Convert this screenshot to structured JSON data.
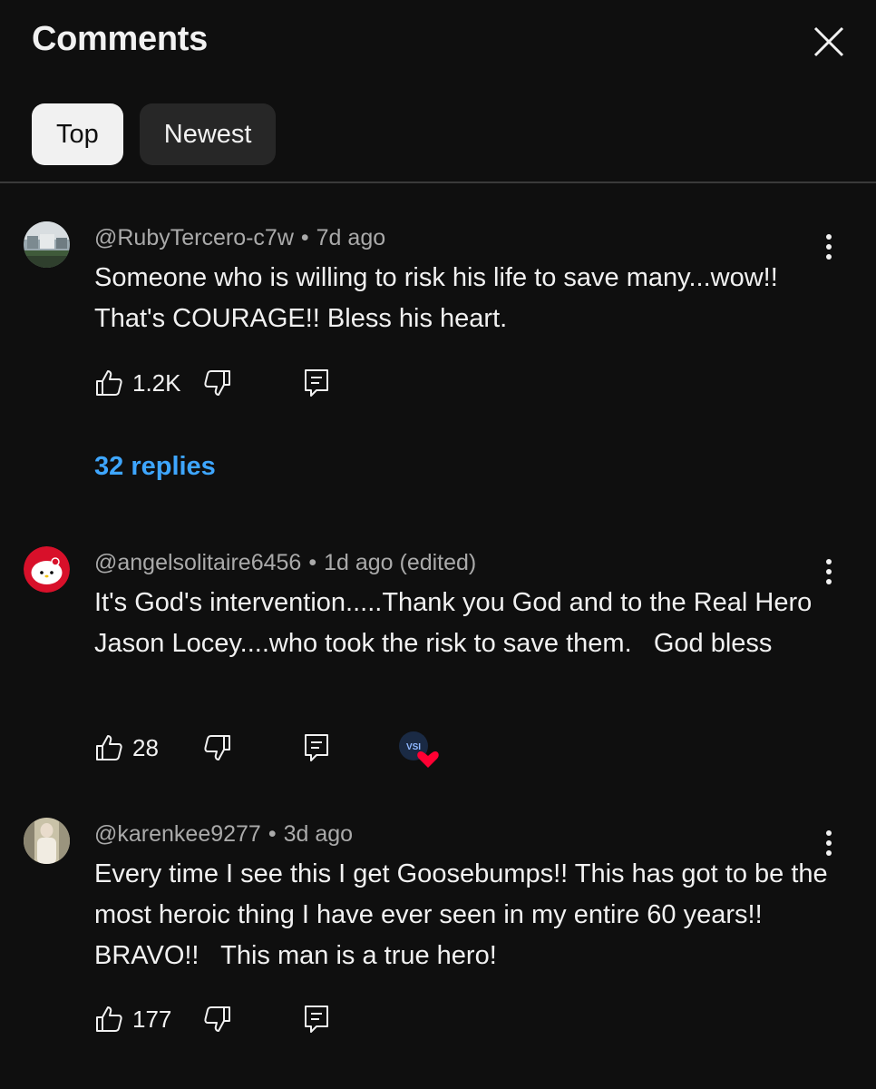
{
  "header": {
    "title": "Comments",
    "close_icon": "close-icon"
  },
  "tabs": [
    {
      "label": "Top",
      "active": true
    },
    {
      "label": "Newest",
      "active": false
    }
  ],
  "comments": [
    {
      "author": "@RubyTercero-c7w",
      "age": "7d ago",
      "text": "Someone who is willing to risk his life to save many...wow!! That's COURAGE!! Bless his heart.",
      "likes": "1.2K",
      "replies": "32 replies",
      "creator_heart": false
    },
    {
      "author": "@angelsolitaire6456",
      "age": "1d ago (edited)",
      "text": "It's God's intervention.....Thank you God and to the Real Hero Jason Locey....who took the risk to save them.   God bless",
      "likes": "28",
      "replies": "",
      "creator_heart": true
    },
    {
      "author": "@karenkee9277",
      "age": "3d ago",
      "text": "Every time I see this I get Goosebumps!! This has got to be the most heroic thing I have ever seen in my entire 60 years!! BRAVO!!   This man is a true hero!",
      "likes": "177",
      "replies": "",
      "creator_heart": false
    }
  ],
  "separator": "•",
  "colors": {
    "background": "#0f0f0f",
    "text": "#f1f1f1",
    "secondary_text": "#aaaaaa",
    "link": "#3ea6ff",
    "chip_active_bg": "#f1f1f1",
    "chip_inactive_bg": "#272727",
    "heart": "#ff0033"
  },
  "icons": [
    "close-icon",
    "thumbs-up-icon",
    "thumbs-down-icon",
    "reply-icon",
    "more-vert-icon",
    "heart-icon"
  ]
}
